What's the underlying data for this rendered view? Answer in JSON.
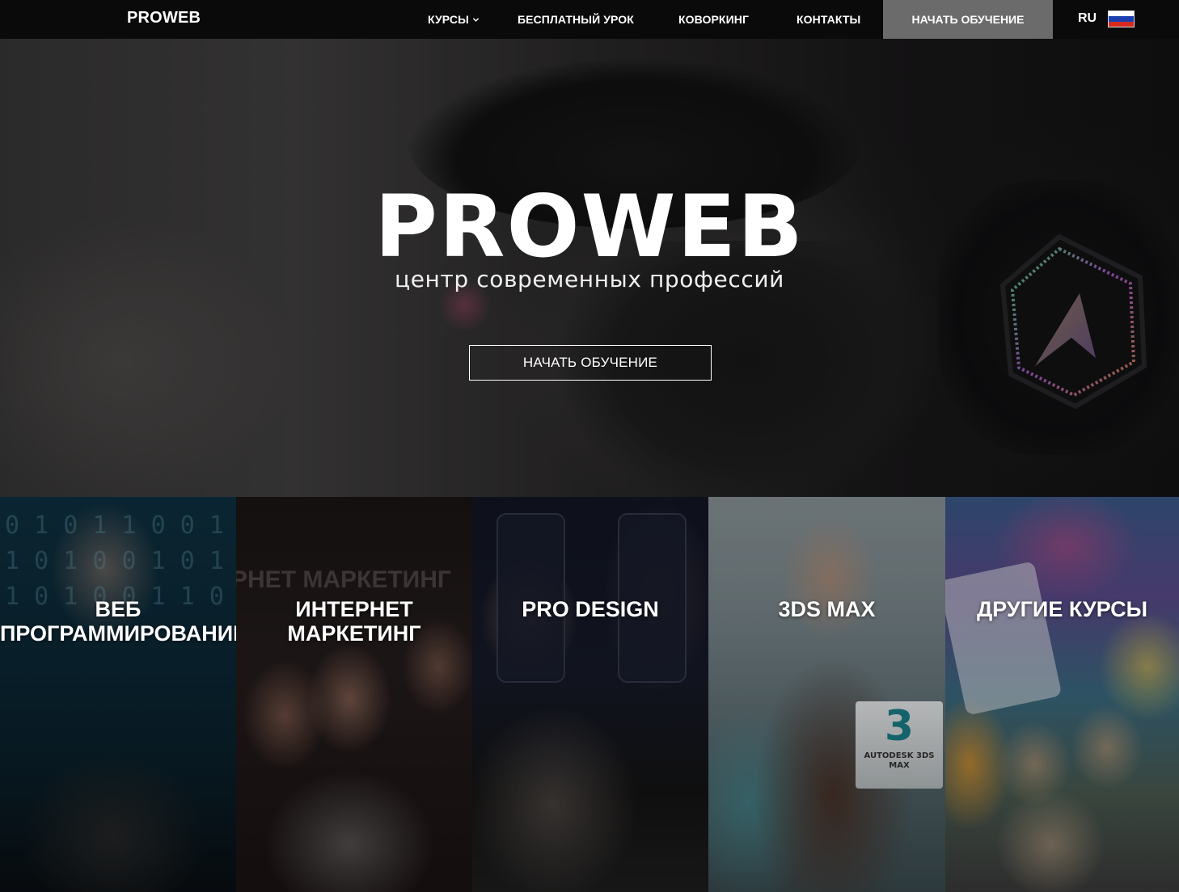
{
  "nav": {
    "logo": "PROWEB",
    "items": [
      {
        "label": "КУРСЫ"
      },
      {
        "label": "БЕСПЛАТНЫЙ УРОК"
      },
      {
        "label": "КОВОРКИНГ"
      },
      {
        "label": "КОНТАКТЫ"
      }
    ],
    "cta": "НАЧАТЬ ОБУЧЕНИЕ",
    "lang": "RU",
    "flag_icon": "russia-flag-icon",
    "colors": {
      "bar": "#0a0a0a",
      "cta_bg": "#6b6b6b"
    }
  },
  "hero": {
    "title": "PROWEB",
    "subtitle": "центр современных профессий",
    "button": "НАЧАТЬ ОБУЧЕНИЕ"
  },
  "courses": [
    {
      "label": "ВЕБ ПРОГРАММИРОВАНИЕ"
    },
    {
      "label": "ИНТЕРНЕТ МАРКЕТИНГ",
      "background_text": "РНЕТ МАРКЕТИНГ"
    },
    {
      "label": "PRO DESIGN"
    },
    {
      "label": "3DS MAX",
      "box_number": "3",
      "box_brand": "AUTODESK 3DS MAX"
    },
    {
      "label": "ДРУГИЕ КУРСЫ"
    }
  ]
}
